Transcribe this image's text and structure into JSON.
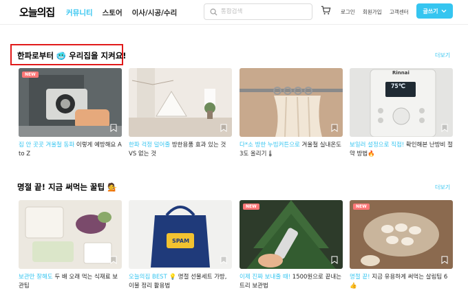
{
  "header": {
    "logo": "오늘의집",
    "nav": [
      "커뮤니티",
      "스토어",
      "이사/시공/수리"
    ],
    "search_placeholder": "통합검색",
    "links": [
      "로그인",
      "회원가입",
      "고객센터"
    ],
    "write_label": "글쓰기"
  },
  "sections": [
    {
      "title": "한파로부터 🥶 우리집을 지켜요!",
      "more": "더보기",
      "cards": [
        {
          "new": "NEW",
          "highlight": "집 안 곳곳 겨울철 동파",
          "text": " 이렇게 예방해요 A to Z"
        },
        {
          "new": "",
          "highlight": "한파 걱정 덜어줄",
          "text": " 방한용품 효과 있는 것 VS 없는 것"
        },
        {
          "new": "",
          "highlight": "다*소 방한 누빔커튼으로",
          "text": " 겨울철 실내온도 3도 올리기🌡"
        },
        {
          "new": "",
          "highlight": "보일러 설정으로 직접!",
          "text": " 확인해본 난방비 절약 방법🔥"
        }
      ]
    },
    {
      "title": "명절 끝! 지금 써먹는 꿀팁 💁",
      "more": "더보기",
      "cards": [
        {
          "new": "",
          "highlight": "보관만 잘해도",
          "text": " 두 배 오래 먹는 식재료 보관팁"
        },
        {
          "new": "",
          "highlight": "오늘의집 BEST",
          "text": " 💡 명절 선물세트 가방, 이불 정리 활용법"
        },
        {
          "new": "NEW",
          "highlight": "이제 진짜 보내줄 때!",
          "text": " 1500원으로 끝내는 트리 보관법"
        },
        {
          "new": "NEW",
          "highlight": "명절 끝!",
          "text": " 지금 유용하게 써먹는 살림팁 6👍"
        }
      ]
    }
  ],
  "image_labels": {
    "rinnai": "Rinnai",
    "temp": "75℃",
    "spam": "SPAM"
  },
  "colors": {
    "accent": "#35c5f0",
    "highlight_box": "#e11919",
    "new_badge": "#ff7777"
  }
}
